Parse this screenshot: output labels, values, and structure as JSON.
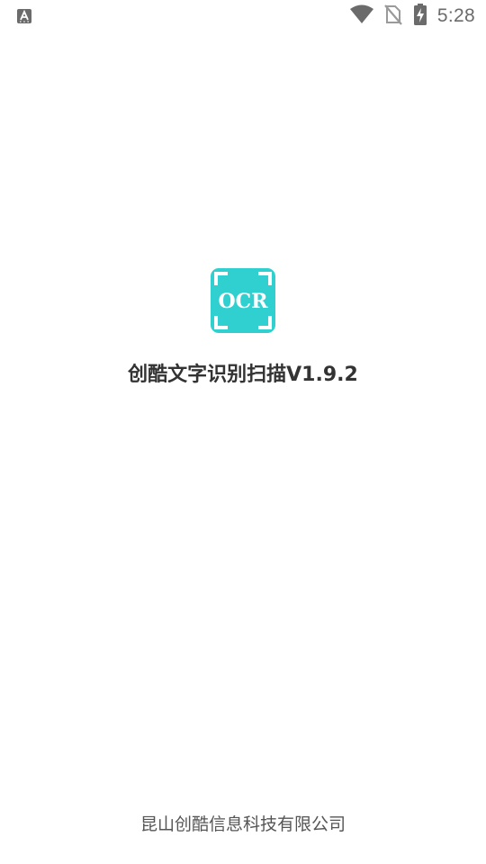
{
  "status_bar": {
    "time": "5:28",
    "icons": [
      "keyboard-a-icon",
      "wifi-icon",
      "no-sim-icon",
      "battery-charging-icon"
    ]
  },
  "splash": {
    "logo_text": "OCR",
    "app_title": "创酷文字识别扫描V1.9.2",
    "company": "昆山创酷信息科技有限公司",
    "logo_color": "#2fd0cf"
  }
}
